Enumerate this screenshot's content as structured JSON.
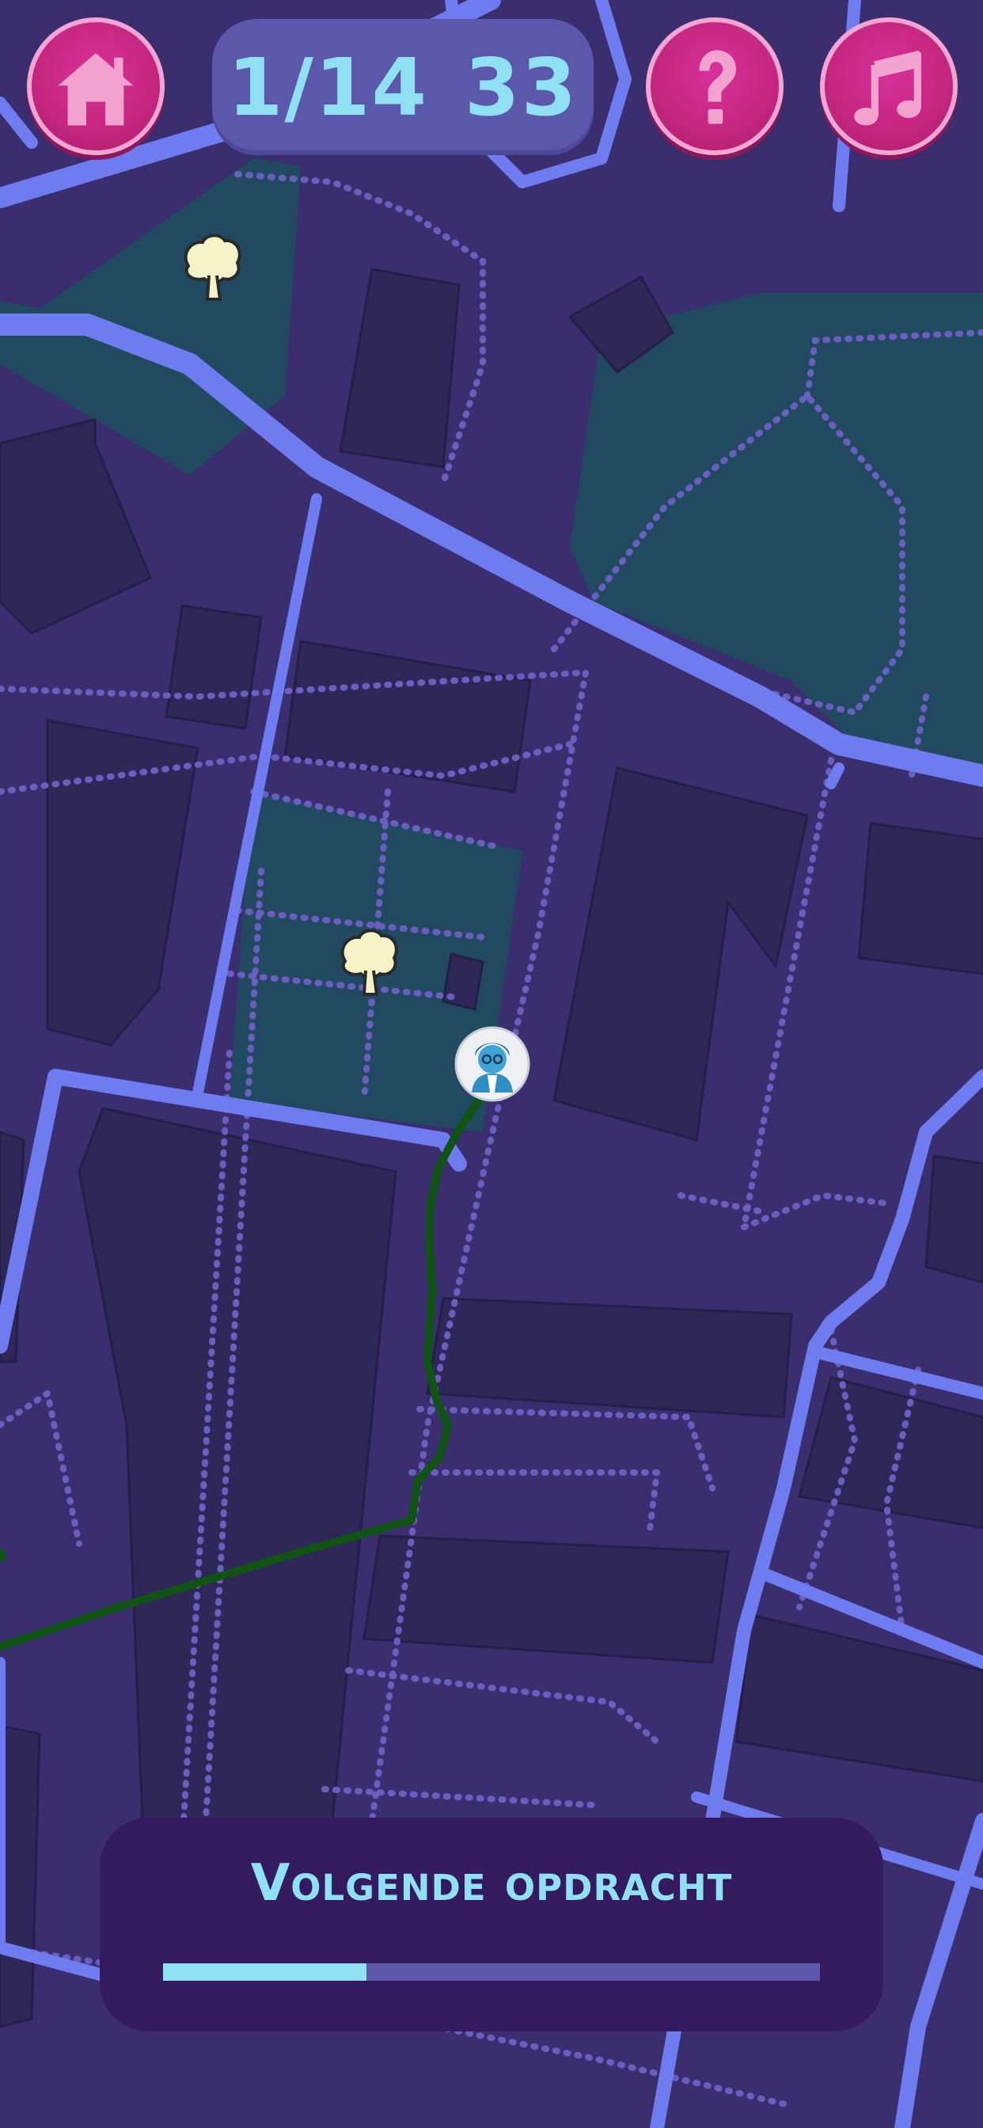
{
  "header": {
    "home_button": {
      "icon": "home-icon"
    },
    "counter": {
      "progress_text": "1/14",
      "score_text": "33"
    },
    "help_button": {
      "icon": "question-icon"
    },
    "music_button": {
      "icon": "music-note-icon"
    }
  },
  "map": {
    "markers": [
      {
        "icon": "tree-icon"
      },
      {
        "icon": "tree-icon"
      },
      {
        "icon": "player-avatar-icon"
      }
    ],
    "colors": {
      "background": "#3a2e6e",
      "block": "#2e2758",
      "park": "#214a61",
      "road": "#6f7cf0",
      "footpath": "#6a5fc0",
      "route": "#0f5412"
    }
  },
  "task_panel": {
    "title": "Volgende opdracht",
    "progress": 0.31
  },
  "colors": {
    "button": "#c4267f",
    "button_border": "#f3a6d4",
    "accent_text": "#8ee0f2",
    "counter_bg": "#5b57ab",
    "panel_bg": "#341a5e"
  }
}
